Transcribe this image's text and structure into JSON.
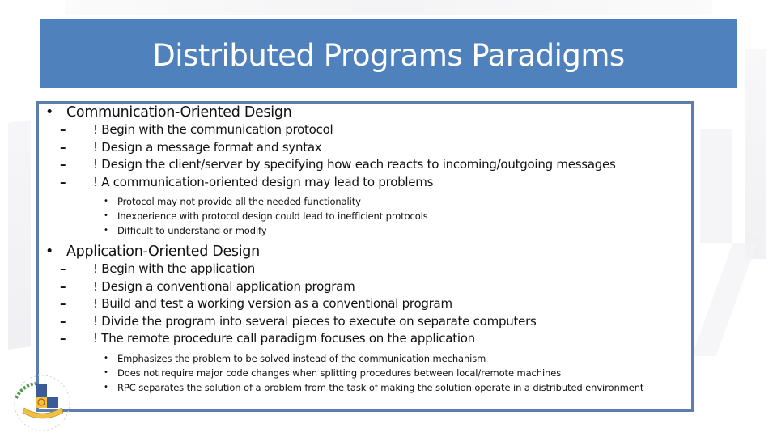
{
  "slide": {
    "title": "Distributed Programs Paradigms",
    "colors": {
      "title_bar": "#4f81bd",
      "title_text": "#ffffff",
      "box_border": "#5a7fae",
      "body_text": "#111111"
    },
    "sections": [
      {
        "heading": "Communication-Oriented Design",
        "bullet_glyph": "•",
        "items": [
          {
            "dash": "–",
            "text": "! Begin with the communication protocol"
          },
          {
            "dash": "–",
            "text": "! Design a message format and syntax"
          },
          {
            "dash": "–",
            "text": "! Design the client/server by specifying how each reacts to incoming/outgoing messages"
          },
          {
            "dash": "–",
            "text": "! A communication-oriented design may lead to problems"
          }
        ],
        "subitems": [
          {
            "dot": "•",
            "text": "Protocol may not provide all the needed functionality"
          },
          {
            "dot": "•",
            "text": "Inexperience with protocol design could lead to inefficient protocols"
          },
          {
            "dot": "•",
            "text": "Difficult to understand or modify"
          }
        ]
      },
      {
        "heading": "Application-Oriented Design",
        "bullet_glyph": "•",
        "items": [
          {
            "dash": "–",
            "text": "! Begin with the application"
          },
          {
            "dash": "–",
            "text": "! Design a conventional application program"
          },
          {
            "dash": "–",
            "text": "! Build and test a working version as a conventional program"
          },
          {
            "dash": "–",
            "text": "! Divide the program into several pieces to execute on separate computers"
          },
          {
            "dash": "–",
            "text": "! The remote procedure call paradigm focuses on the application"
          }
        ],
        "subitems": [
          {
            "dot": "•",
            "text": "Emphasizes the problem to be solved instead of the communication mechanism"
          },
          {
            "dot": "•",
            "text": "Does not require major code changes when splitting procedures between local/remote machines"
          },
          {
            "dot": "•",
            "text": "RPC separates the solution of a problem from the task of making the solution operate in a distributed environment"
          }
        ]
      }
    ],
    "logo": {
      "icon": "university-seal-icon"
    }
  }
}
